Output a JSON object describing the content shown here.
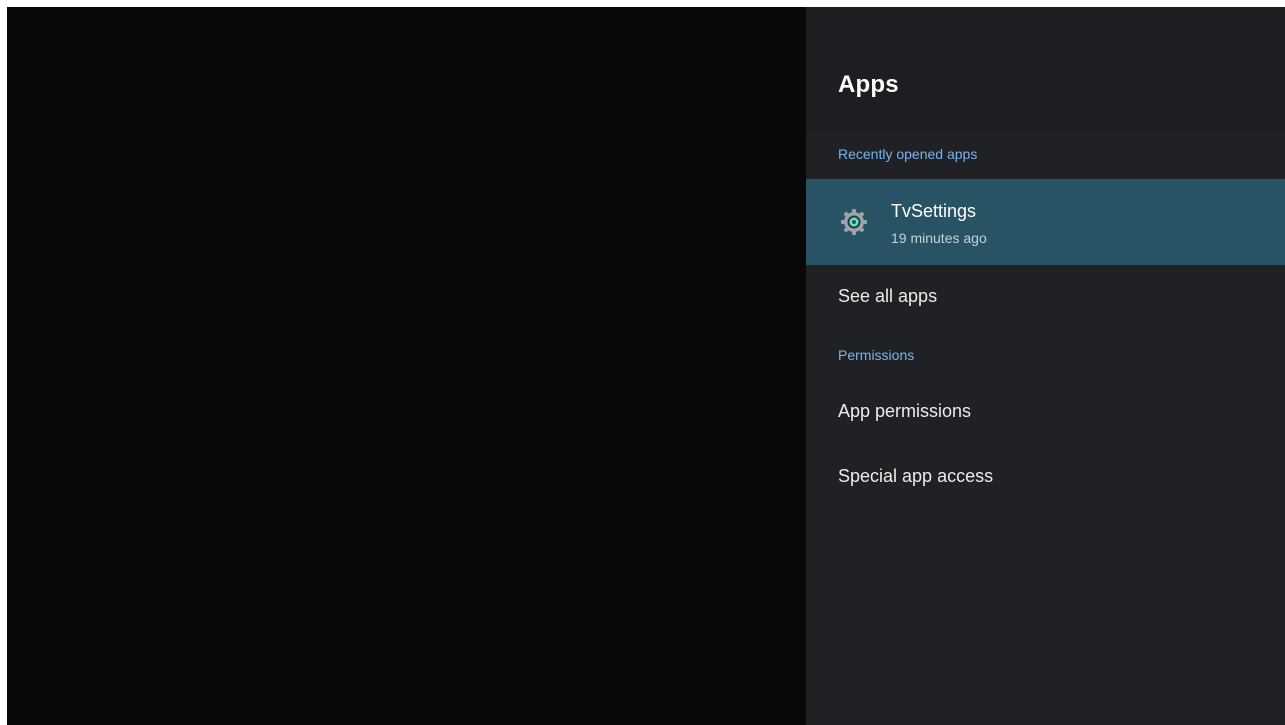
{
  "panel": {
    "title": "Apps",
    "sections": {
      "recent_header": "Recently opened apps",
      "permissions_header": "Permissions"
    },
    "recent_apps": [
      {
        "name": "TvSettings",
        "subtitle": "19 minutes ago",
        "icon": "gear-icon"
      }
    ],
    "items": {
      "see_all": "See all apps",
      "app_permissions": "App permissions",
      "special_access": "Special app access"
    }
  },
  "colors": {
    "background": "#080808",
    "panel": "#202124",
    "panel_header": "#1c1e21",
    "selected_row": "#275364",
    "section_accent": "#78b3f0",
    "icon_accent": "#5ee7c6"
  }
}
